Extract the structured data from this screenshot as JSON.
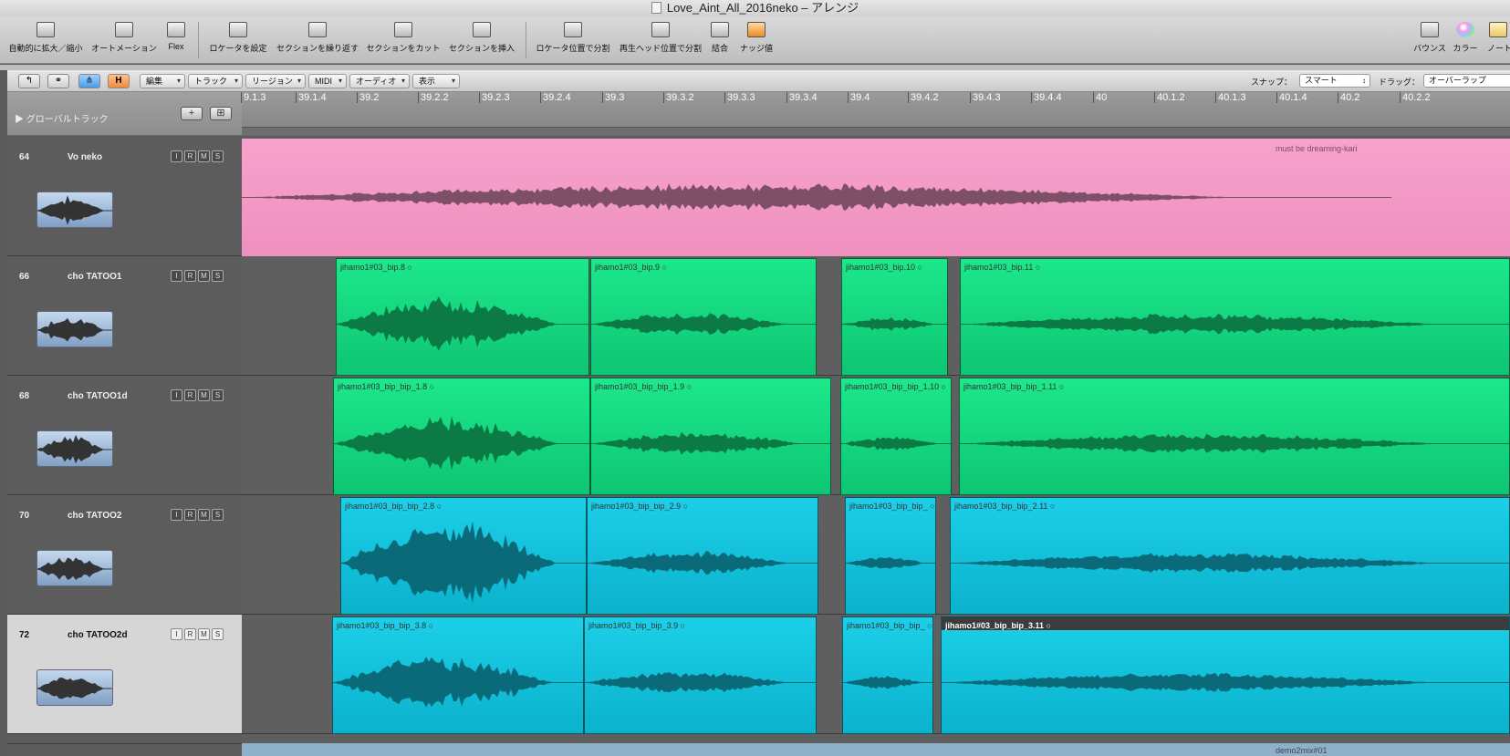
{
  "window": {
    "title": "Love_Aint_All_2016neko – アレンジ"
  },
  "toolbar": {
    "items": [
      {
        "id": "auto-zoom",
        "label": "自動的に拡大／縮小",
        "icon": "auto-zoom-icon"
      },
      {
        "id": "automation",
        "label": "オートメーション",
        "icon": "automation-icon"
      },
      {
        "id": "flex",
        "label": "Flex",
        "icon": "flex-icon"
      },
      {
        "id": "set-locators",
        "label": "ロケータを設定",
        "icon": "set-locators-icon"
      },
      {
        "id": "repeat-section",
        "label": "セクションを繰り返す",
        "icon": "repeat-section-icon"
      },
      {
        "id": "cut-section",
        "label": "セクションをカット",
        "icon": "cut-section-icon"
      },
      {
        "id": "insert-section",
        "label": "セクションを挿入",
        "icon": "insert-section-icon"
      },
      {
        "id": "split-locators",
        "label": "ロケータ位置で分割",
        "icon": "split-locators-icon"
      },
      {
        "id": "split-playhead",
        "label": "再生ヘッド位置で分割",
        "icon": "split-playhead-icon"
      },
      {
        "id": "join",
        "label": "結合",
        "icon": "join-icon"
      },
      {
        "id": "nudge",
        "label": "ナッジ値",
        "icon": "nudge-icon"
      },
      {
        "id": "bounce",
        "label": "バウンス",
        "icon": "bounce-icon"
      },
      {
        "id": "color",
        "label": "カラー",
        "icon": "color-icon"
      },
      {
        "id": "notes",
        "label": "ノート",
        "icon": "notes-icon"
      }
    ]
  },
  "local_bar": {
    "menus": [
      "編集",
      "トラック",
      "リージョン",
      "MIDI",
      "オーディオ",
      "表示"
    ],
    "snap_label": "スナップ：",
    "snap_value": "スマート",
    "drag_label": "ドラッグ：",
    "drag_value": "オーバーラップ"
  },
  "global_tracks": {
    "label": "▶ グローバルトラック"
  },
  "ruler": {
    "labels": [
      "9.1.3",
      "39.1.4",
      "39.2",
      "39.2.2",
      "39.2.3",
      "39.2.4",
      "39.3",
      "39.3.2",
      "39.3.3",
      "39.3.4",
      "39.4",
      "39.4.2",
      "39.4.3",
      "39.4.4",
      "40",
      "40.1.2",
      "40.1.3",
      "40.1.4",
      "40.2",
      "40.2.2"
    ]
  },
  "tracks": [
    {
      "number": "64",
      "name": "Vo neko",
      "selected": false,
      "color": "#f7a2cc",
      "region_label": "must be dreaming-kari",
      "regions": []
    },
    {
      "number": "66",
      "name": "cho TATOO1",
      "selected": false,
      "color": "#16dd83",
      "regions": [
        {
          "name": "jihamo1#03_bip.8"
        },
        {
          "name": "jihamo1#03_bip.9"
        },
        {
          "name": "jihamo1#03_bip.10"
        },
        {
          "name": "jihamo1#03_bip.11"
        }
      ]
    },
    {
      "number": "68",
      "name": "cho TATOO1d",
      "selected": false,
      "color": "#16dd83",
      "regions": [
        {
          "name": "jihamo1#03_bip_bip_1.8"
        },
        {
          "name": "jihamo1#03_bip_bip_1.9"
        },
        {
          "name": "jihamo1#03_bip_bip_1.10"
        },
        {
          "name": "jihamo1#03_bip_bip_1.11"
        }
      ]
    },
    {
      "number": "70",
      "name": "cho TATOO2",
      "selected": false,
      "color": "#14c6e0",
      "regions": [
        {
          "name": "jihamo1#03_bip_bip_2.8"
        },
        {
          "name": "jihamo1#03_bip_bip_2.9"
        },
        {
          "name": "jihamo1#03_bip_bip_"
        },
        {
          "name": "jihamo1#03_bip_bip_2.11"
        }
      ]
    },
    {
      "number": "72",
      "name": "cho TATOO2d",
      "selected": true,
      "color": "#14c6e0",
      "regions": [
        {
          "name": "jihamo1#03_bip_bip_3.8"
        },
        {
          "name": "jihamo1#03_bip_bip_3.9"
        },
        {
          "name": "jihamo1#03_bip_bip_"
        },
        {
          "name": "jihamo1#03_bip_bip_3.11",
          "active": true
        }
      ]
    }
  ],
  "track_buttons": [
    "I",
    "R",
    "M",
    "S"
  ],
  "bottom_region": {
    "label": "demo2mix#01"
  }
}
